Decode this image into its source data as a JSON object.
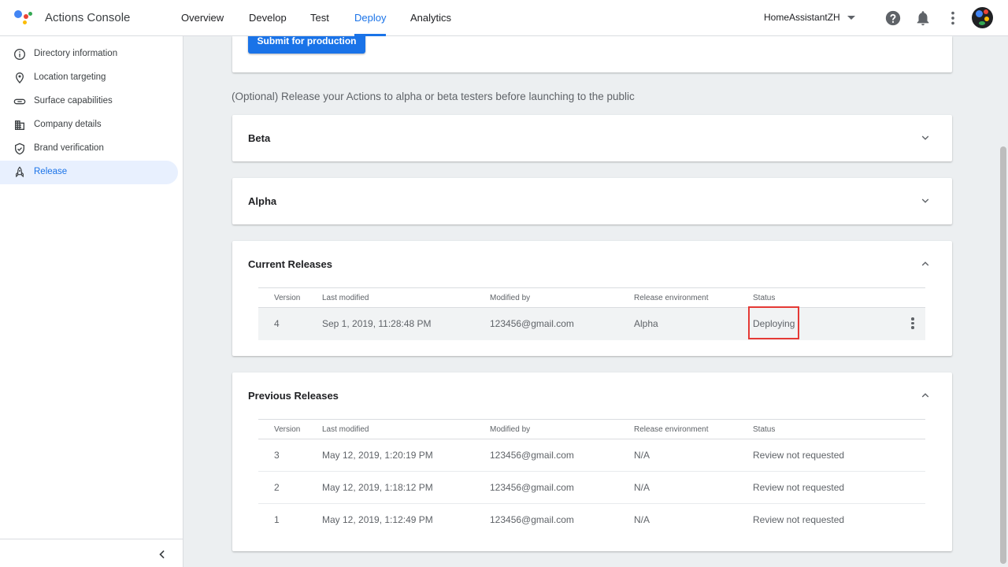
{
  "header": {
    "app_title": "Actions Console",
    "tabs": [
      {
        "label": "Overview"
      },
      {
        "label": "Develop"
      },
      {
        "label": "Test"
      },
      {
        "label": "Deploy",
        "active": true
      },
      {
        "label": "Analytics"
      }
    ],
    "project_name": "HomeAssistantZH",
    "icons": [
      "help-icon",
      "notifications-icon",
      "more-vert-icon",
      "account-avatar"
    ]
  },
  "sidebar": {
    "items": [
      {
        "label": "Directory information",
        "icon": "info-icon"
      },
      {
        "label": "Location targeting",
        "icon": "location-pin-icon"
      },
      {
        "label": "Surface capabilities",
        "icon": "link-icon"
      },
      {
        "label": "Company details",
        "icon": "building-icon"
      },
      {
        "label": "Brand verification",
        "icon": "shield-check-icon"
      },
      {
        "label": "Release",
        "icon": "rocket-icon",
        "active": true
      }
    ],
    "collapse_icon": "chevron-left-icon"
  },
  "main": {
    "submit_button": "Submit for production",
    "optional_text": "(Optional) Release your Actions to alpha or beta testers before launching to the public",
    "beta_title": "Beta",
    "alpha_title": "Alpha",
    "columns": [
      "Version",
      "Last modified",
      "Modified by",
      "Release environment",
      "Status"
    ],
    "current_releases": {
      "title": "Current Releases",
      "rows": [
        [
          "4",
          "Sep 1, 2019, 11:28:48 PM",
          "123456@gmail.com",
          "Alpha",
          "Deploying"
        ]
      ]
    },
    "previous_releases": {
      "title": "Previous Releases",
      "rows": [
        [
          "3",
          "May 12, 2019, 1:20:19 PM",
          "123456@gmail.com",
          "N/A",
          "Review not requested"
        ],
        [
          "2",
          "May 12, 2019, 1:18:12 PM",
          "123456@gmail.com",
          "N/A",
          "Review not requested"
        ],
        [
          "1",
          "May 12, 2019, 1:12:49 PM",
          "123456@gmail.com",
          "N/A",
          "Review not requested"
        ]
      ]
    }
  },
  "colors": {
    "accent": "#1a73e8",
    "highlight_box": "#e53935",
    "active_sidebar_bg": "#e8f0fe"
  }
}
